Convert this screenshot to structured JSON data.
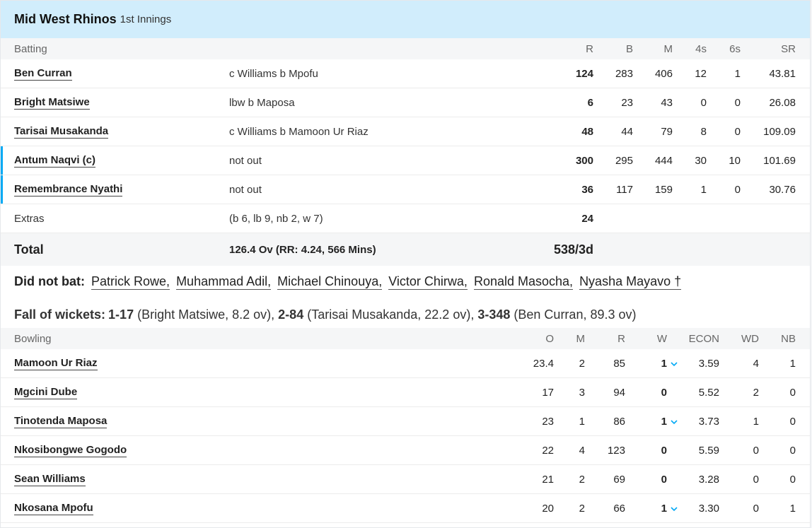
{
  "header": {
    "team": "Mid West Rhinos",
    "innings": "1st Innings"
  },
  "batting": {
    "headers": {
      "title": "Batting",
      "r": "R",
      "b": "B",
      "m": "M",
      "fours": "4s",
      "sixes": "6s",
      "sr": "SR"
    },
    "rows": [
      {
        "name": "Ben Curran",
        "dismissal": "c Williams b Mpofu",
        "r": "124",
        "b": "283",
        "m": "406",
        "fours": "12",
        "sixes": "1",
        "sr": "43.81"
      },
      {
        "name": "Bright Matsiwe",
        "dismissal": "lbw b Maposa",
        "r": "6",
        "b": "23",
        "m": "43",
        "fours": "0",
        "sixes": "0",
        "sr": "26.08"
      },
      {
        "name": "Tarisai Musakanda",
        "dismissal": "c Williams b Mamoon Ur Riaz",
        "r": "48",
        "b": "44",
        "m": "79",
        "fours": "8",
        "sixes": "0",
        "sr": "109.09"
      },
      {
        "name": "Antum Naqvi (c)",
        "dismissal": "not out",
        "r": "300",
        "b": "295",
        "m": "444",
        "fours": "30",
        "sixes": "10",
        "sr": "101.69"
      },
      {
        "name": "Remembrance Nyathi",
        "dismissal": "not out",
        "r": "36",
        "b": "117",
        "m": "159",
        "fours": "1",
        "sixes": "0",
        "sr": "30.76"
      }
    ],
    "extras": {
      "label": "Extras",
      "detail": "(b 6, lb 9, nb 2, w 7)",
      "value": "24"
    },
    "total": {
      "label": "Total",
      "overs": "126.4 Ov (RR: 4.24, 566 Mins)",
      "score": "538/3d"
    }
  },
  "did_not_bat": {
    "label": "Did not bat:",
    "players": [
      "Patrick Rowe,",
      "Muhammad Adil,",
      "Michael Chinouya,",
      "Victor Chirwa,",
      "Ronald Masocha,",
      "Nyasha Mayavo †"
    ]
  },
  "fall_of_wickets": {
    "label": "Fall of wickets:",
    "items": [
      {
        "score": "1-17",
        "detail": "(Bright Matsiwe, 8.2 ov),",
        "sep": " "
      },
      {
        "score": "2-84",
        "detail": "(Tarisai Musakanda, 22.2 ov),",
        "sep": " "
      },
      {
        "score": "3-348",
        "detail": "(Ben Curran, 89.3 ov)",
        "sep": ""
      }
    ]
  },
  "bowling": {
    "headers": {
      "title": "Bowling",
      "o": "O",
      "m": "M",
      "r": "R",
      "w": "W",
      "econ": "ECON",
      "wd": "WD",
      "nb": "NB"
    },
    "rows": [
      {
        "name": "Mamoon Ur Riaz",
        "o": "23.4",
        "m": "2",
        "r": "85",
        "w": "1",
        "expand": true,
        "econ": "3.59",
        "wd": "4",
        "nb": "1"
      },
      {
        "name": "Mgcini Dube",
        "o": "17",
        "m": "3",
        "r": "94",
        "w": "0",
        "expand": false,
        "econ": "5.52",
        "wd": "2",
        "nb": "0"
      },
      {
        "name": "Tinotenda Maposa",
        "o": "23",
        "m": "1",
        "r": "86",
        "w": "1",
        "expand": true,
        "econ": "3.73",
        "wd": "1",
        "nb": "0"
      },
      {
        "name": "Nkosibongwe Gogodo",
        "o": "22",
        "m": "4",
        "r": "123",
        "w": "0",
        "expand": false,
        "econ": "5.59",
        "wd": "0",
        "nb": "0"
      },
      {
        "name": "Sean Williams",
        "o": "21",
        "m": "2",
        "r": "69",
        "w": "0",
        "expand": false,
        "econ": "3.28",
        "wd": "0",
        "nb": "0"
      },
      {
        "name": "Nkosana Mpofu",
        "o": "20",
        "m": "2",
        "r": "66",
        "w": "1",
        "expand": true,
        "econ": "3.30",
        "wd": "0",
        "nb": "1"
      }
    ]
  },
  "colors": {
    "header_bg": "#d1edfc",
    "accent": "#03a9f4"
  }
}
